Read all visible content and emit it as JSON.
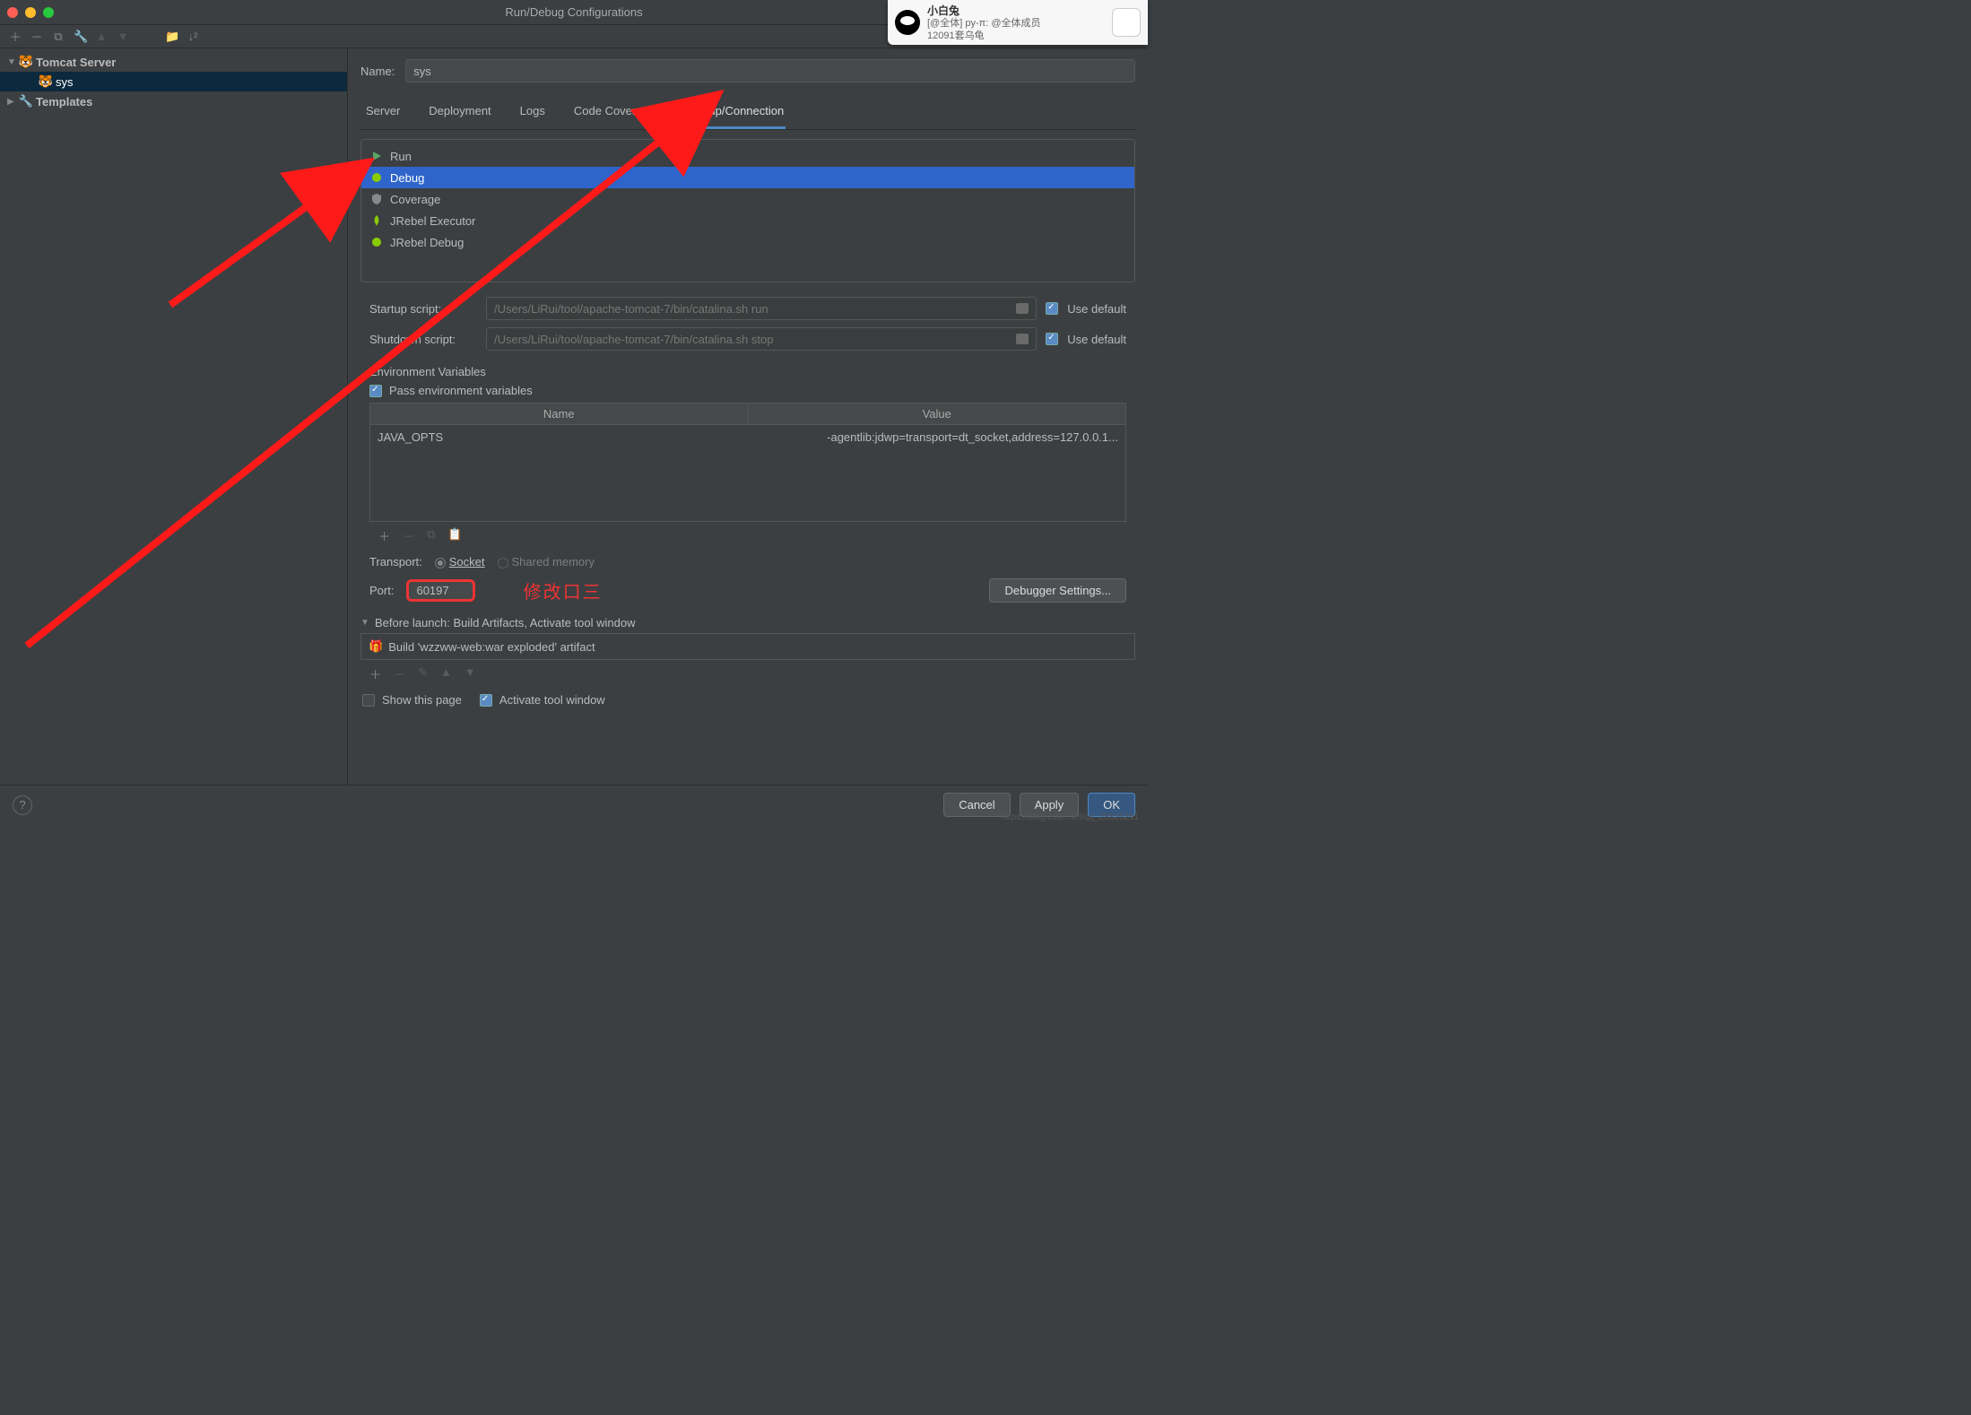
{
  "window": {
    "title": "Run/Debug Configurations"
  },
  "tree": {
    "tomcat": "Tomcat Server",
    "sys": "sys",
    "templates": "Templates"
  },
  "name": {
    "label": "Name:",
    "value": "sys"
  },
  "tabs": {
    "server": "Server",
    "deployment": "Deployment",
    "logs": "Logs",
    "coverage": "Code Coverage",
    "startup": "Startup/Connection"
  },
  "modes": {
    "run": "Run",
    "debug": "Debug",
    "coverage": "Coverage",
    "jexec": "JRebel Executor",
    "jdebug": "JRebel Debug"
  },
  "scripts": {
    "startup_label": "Startup script:",
    "startup_value": "/Users/LiRui/tool/apache-tomcat-7/bin/catalina.sh run",
    "shutdown_label": "Shutdown script:",
    "shutdown_value": "/Users/LiRui/tool/apache-tomcat-7/bin/catalina.sh stop",
    "use_default": "Use default"
  },
  "env": {
    "title": "Environment Variables",
    "pass": "Pass environment variables",
    "col_name": "Name",
    "col_value": "Value",
    "row_name": "JAVA_OPTS",
    "row_value": "-agentlib:jdwp=transport=dt_socket,address=127.0.0.1..."
  },
  "transport": {
    "label": "Transport:",
    "socket": "Socket",
    "shared": "Shared memory"
  },
  "port": {
    "label": "Port:",
    "value": "60197",
    "note": "修改口三"
  },
  "debugger_btn": "Debugger Settings...",
  "before": {
    "head": "Before launch: Build Artifacts, Activate tool window",
    "item": "Build 'wzzww-web:war exploded' artifact",
    "show": "Show this page",
    "activate": "Activate tool window"
  },
  "footer": {
    "cancel": "Cancel",
    "apply": "Apply",
    "ok": "OK"
  },
  "notif": {
    "name": "小白兔",
    "line1": "[@全体] py-π: @全体成员",
    "line2": "12091套乌龟"
  },
  "watermark": "https://blog.csdn.net/qq_28325291"
}
